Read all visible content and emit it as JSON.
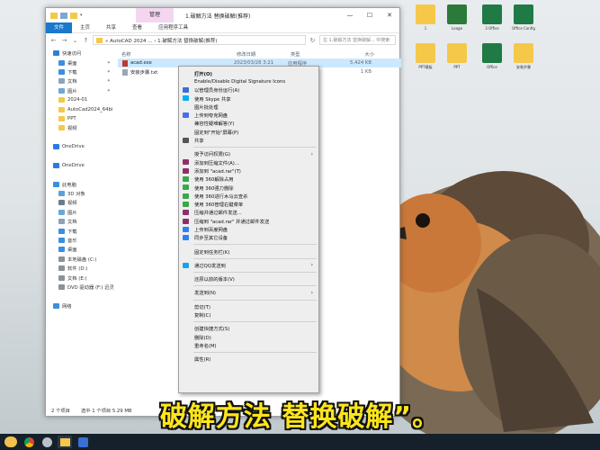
{
  "window": {
    "context_tab": "管理",
    "title": "1.破解方法 替换破解(推荐)"
  },
  "ribbon": {
    "tabs": [
      {
        "label": "文件",
        "active": true
      },
      {
        "label": "主页",
        "active": false
      },
      {
        "label": "共享",
        "active": false
      },
      {
        "label": "查看",
        "active": false
      },
      {
        "label": "应用程序工具",
        "active": false
      }
    ]
  },
  "address": {
    "path": "« AutoCAD 2024 ... › 1.破解方法 替换破解(推荐)",
    "search_placeholder": "在 1.破解方法 替换破解... 中搜索"
  },
  "nav": [
    {
      "label": "快速访问",
      "icon": "star-icon",
      "sub": false,
      "pin": false
    },
    {
      "label": "桌面",
      "icon": "desktop-icon",
      "sub": true,
      "pin": true
    },
    {
      "label": "下载",
      "icon": "download-icon",
      "sub": true,
      "pin": true
    },
    {
      "label": "文档",
      "icon": "document-icon",
      "sub": true,
      "pin": true
    },
    {
      "label": "图片",
      "icon": "picture-icon",
      "sub": true,
      "pin": true
    },
    {
      "label": "2024-01",
      "icon": "folder-icon",
      "sub": true,
      "pin": false
    },
    {
      "label": "AutoCad2024_64bi",
      "icon": "folder-icon",
      "sub": true,
      "pin": false
    },
    {
      "label": "PPT",
      "icon": "folder-icon",
      "sub": true,
      "pin": false
    },
    {
      "label": "视频",
      "icon": "folder-icon",
      "sub": true,
      "pin": false
    },
    {
      "label": "",
      "icon": "",
      "sub": false,
      "pin": false
    },
    {
      "label": "OneDrive",
      "icon": "cloud-icon",
      "sub": false,
      "pin": false
    },
    {
      "label": "",
      "icon": "",
      "sub": false,
      "pin": false
    },
    {
      "label": "OneDrive",
      "icon": "cloud-icon",
      "sub": false,
      "pin": false
    },
    {
      "label": "",
      "icon": "",
      "sub": false,
      "pin": false
    },
    {
      "label": "此电脑",
      "icon": "computer-icon",
      "sub": false,
      "pin": false
    },
    {
      "label": "3D 对象",
      "icon": "cube-icon",
      "sub": true,
      "pin": false
    },
    {
      "label": "视频",
      "icon": "video-icon",
      "sub": true,
      "pin": false
    },
    {
      "label": "图片",
      "icon": "picture-icon",
      "sub": true,
      "pin": false
    },
    {
      "label": "文档",
      "icon": "document-icon",
      "sub": true,
      "pin": false
    },
    {
      "label": "下载",
      "icon": "download-icon",
      "sub": true,
      "pin": false
    },
    {
      "label": "音乐",
      "icon": "music-icon",
      "sub": true,
      "pin": false
    },
    {
      "label": "桌面",
      "icon": "desktop-icon",
      "sub": true,
      "pin": false
    },
    {
      "label": "本地磁盘 (C:)",
      "icon": "drive-icon",
      "sub": true,
      "pin": false
    },
    {
      "label": "软件 (D:)",
      "icon": "drive-icon",
      "sub": true,
      "pin": false
    },
    {
      "label": "文档 (E:)",
      "icon": "drive-icon",
      "sub": true,
      "pin": false
    },
    {
      "label": "DVD 驱动器 (F:) 迅灵",
      "icon": "dvd-icon",
      "sub": true,
      "pin": false
    },
    {
      "label": "",
      "icon": "",
      "sub": false,
      "pin": false
    },
    {
      "label": "网络",
      "icon": "network-icon",
      "sub": false,
      "pin": false
    }
  ],
  "columns": [
    "名称",
    "修改日期",
    "类型",
    "大小"
  ],
  "files": [
    {
      "name": "acad.exe",
      "date": "2023/03/28 3:21",
      "type": "应用程序",
      "size": "5,424 KB",
      "selected": true,
      "icon": "exe-icon"
    },
    {
      "name": "安装步骤.txt",
      "date": "2024/01/15 10:22",
      "type": "文本文档",
      "size": "1 KB",
      "selected": false,
      "icon": "txt-icon"
    }
  ],
  "status": {
    "count": "2 个项目",
    "selected": "选中 1 个项目  5.29 MB"
  },
  "context_menu": [
    {
      "type": "item",
      "label": "打开(O)",
      "icon": "",
      "bold": true,
      "submenu": false
    },
    {
      "type": "item",
      "label": "Enable/Disable Digital Signature Icons",
      "icon": "",
      "bold": false,
      "submenu": false
    },
    {
      "type": "item",
      "label": "以管理员身份运行(A)",
      "icon": "shield-icon",
      "bold": false,
      "submenu": false
    },
    {
      "type": "item",
      "label": "使用 Skype 共享",
      "icon": "skype-icon",
      "bold": false,
      "submenu": false
    },
    {
      "type": "item",
      "label": "图片批处理",
      "icon": "",
      "bold": false,
      "submenu": false
    },
    {
      "type": "item",
      "label": "上传到夸克网盘",
      "icon": "quark-icon",
      "bold": false,
      "submenu": false
    },
    {
      "type": "item",
      "label": "兼容性疑难解答(Y)",
      "icon": "",
      "bold": false,
      "submenu": false
    },
    {
      "type": "item",
      "label": "固定到\"开始\"屏幕(P)",
      "icon": "",
      "bold": false,
      "submenu": false
    },
    {
      "type": "item",
      "label": "共享",
      "icon": "share-icon",
      "bold": false,
      "submenu": false
    },
    {
      "type": "sep"
    },
    {
      "type": "item",
      "label": "授予访问权限(G)",
      "icon": "",
      "bold": false,
      "submenu": true
    },
    {
      "type": "item",
      "label": "添加到压缩文件(A)...",
      "icon": "rar-icon",
      "bold": false,
      "submenu": false
    },
    {
      "type": "item",
      "label": "添加到 \"acad.rar\"(T)",
      "icon": "rar-icon",
      "bold": false,
      "submenu": false
    },
    {
      "type": "item",
      "label": "使用 360解除占用",
      "icon": "360-icon",
      "bold": false,
      "submenu": false
    },
    {
      "type": "item",
      "label": "使用 360强力删除",
      "icon": "360-icon",
      "bold": false,
      "submenu": false
    },
    {
      "type": "item",
      "label": "使用 360进行木马云查杀",
      "icon": "360-icon",
      "bold": false,
      "submenu": false
    },
    {
      "type": "item",
      "label": "使用 360管理右键菜单",
      "icon": "360-icon",
      "bold": false,
      "submenu": false
    },
    {
      "type": "item",
      "label": "压缩并通过邮件发送...",
      "icon": "rar-icon",
      "bold": false,
      "submenu": false
    },
    {
      "type": "item",
      "label": "压缩到 \"acad.rar\" 并通过邮件发送",
      "icon": "rar-icon",
      "bold": false,
      "submenu": false
    },
    {
      "type": "item",
      "label": "上传到百度网盘",
      "icon": "baidu-icon",
      "bold": false,
      "submenu": false
    },
    {
      "type": "item",
      "label": "同步至其它设备",
      "icon": "baidu-icon",
      "bold": false,
      "submenu": false
    },
    {
      "type": "sep"
    },
    {
      "type": "item",
      "label": "固定到任务栏(K)",
      "icon": "",
      "bold": false,
      "submenu": false
    },
    {
      "type": "sep"
    },
    {
      "type": "item",
      "label": "通过QQ发送到",
      "icon": "qq-icon",
      "bold": false,
      "submenu": true
    },
    {
      "type": "sep"
    },
    {
      "type": "item",
      "label": "还原以前的版本(V)",
      "icon": "",
      "bold": false,
      "submenu": false
    },
    {
      "type": "sep"
    },
    {
      "type": "item",
      "label": "发送到(N)",
      "icon": "",
      "bold": false,
      "submenu": true
    },
    {
      "type": "sep"
    },
    {
      "type": "item",
      "label": "剪切(T)",
      "icon": "",
      "bold": false,
      "submenu": false
    },
    {
      "type": "item",
      "label": "复制(C)",
      "icon": "",
      "bold": false,
      "submenu": false
    },
    {
      "type": "sep"
    },
    {
      "type": "item",
      "label": "创建快捷方式(S)",
      "icon": "",
      "bold": false,
      "submenu": false
    },
    {
      "type": "item",
      "label": "删除(D)",
      "icon": "",
      "bold": false,
      "submenu": false
    },
    {
      "type": "item",
      "label": "重命名(M)",
      "icon": "",
      "bold": false,
      "submenu": false
    },
    {
      "type": "sep"
    },
    {
      "type": "item",
      "label": "属性(R)",
      "icon": "",
      "bold": false,
      "submenu": false
    }
  ],
  "desktop_icons": [
    {
      "label": "1",
      "icon": "folder-icon"
    },
    {
      "label": "Leage",
      "icon": "app-icon"
    },
    {
      "label": "3 Office",
      "icon": "excel-icon"
    },
    {
      "label": "Office Config",
      "icon": "excel-icon"
    },
    {
      "label": "PPT模板",
      "icon": "folder-icon"
    },
    {
      "label": "PPT",
      "icon": "folder-icon"
    },
    {
      "label": "Office",
      "icon": "excel-icon"
    },
    {
      "label": "安装步骤",
      "icon": "folder-icon"
    }
  ],
  "subtitle": "破解方法 替换破解”。",
  "icon_colors": {
    "folder-icon": "#f5c84a",
    "desktop-icon": "#3a8ee6",
    "download-icon": "#3a8ee6",
    "document-icon": "#8ca3b8",
    "picture-icon": "#6aa8dc",
    "star-icon": "#2f7fd9",
    "cloud-icon": "#2a7be4",
    "computer-icon": "#3b8fe0",
    "cube-icon": "#5aa0e0",
    "video-icon": "#6e7c8c",
    "music-icon": "#3a8ee6",
    "drive-icon": "#8a9199",
    "dvd-icon": "#8a9199",
    "network-icon": "#3b8fe0",
    "exe-icon": "#c0392b",
    "txt-icon": "#9aa7b4",
    "shield-icon": "#3a6fd6",
    "skype-icon": "#00aff0",
    "quark-icon": "#4b6cf0",
    "share-icon": "#555555",
    "rar-icon": "#8e2f6a",
    "360-icon": "#3aa84a",
    "baidu-icon": "#2f80ed",
    "qq-icon": "#1aa3e8",
    "app-icon": "#2c7a3a",
    "excel-icon": "#1f7a45"
  }
}
